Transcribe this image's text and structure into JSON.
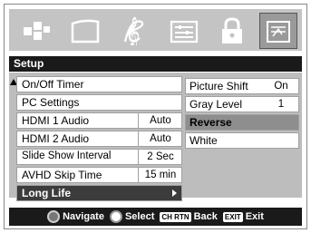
{
  "title": "Setup",
  "icons": [
    "picture-icon",
    "screen-icon",
    "music-icon",
    "settings-sliders-icon",
    "lock-icon",
    "setup-icon"
  ],
  "menu": [
    {
      "label": "On/Off Timer",
      "value": ""
    },
    {
      "label": "PC Settings",
      "value": ""
    },
    {
      "label": "HDMI 1 Audio",
      "value": "Auto"
    },
    {
      "label": "HDMI 2 Audio",
      "value": "Auto"
    },
    {
      "label": "Slide Show Interval",
      "value": "2 Sec"
    },
    {
      "label": "AVHD Skip Time",
      "value": "15 min"
    },
    {
      "label": "Long Life",
      "value": ""
    }
  ],
  "submenu": [
    {
      "label": "Picture Shift",
      "value": "On"
    },
    {
      "label": "Gray Level",
      "value": "1"
    },
    {
      "label": "Reverse",
      "value": ""
    },
    {
      "label": "White",
      "value": ""
    }
  ],
  "footer": {
    "navigate": "Navigate",
    "select": "Select",
    "back_key": "CH RTN",
    "back": "Back",
    "exit_key": "EXIT",
    "exit": "Exit"
  }
}
